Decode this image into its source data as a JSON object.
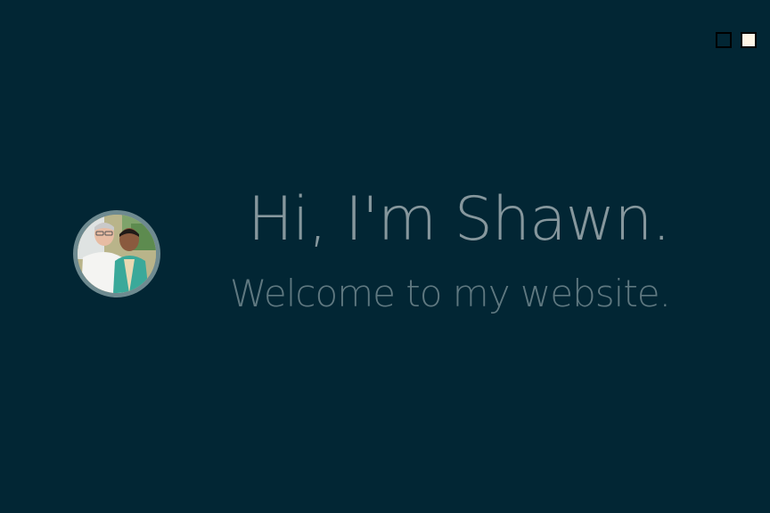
{
  "theme_switcher": {
    "options": [
      "dark",
      "light"
    ],
    "colors": {
      "dark": "#022634",
      "light": "#fdf5e6"
    }
  },
  "hero": {
    "headline": "Hi, I'm Shawn.",
    "subheadline": "Welcome to my website."
  },
  "colors": {
    "background": "#022634",
    "headline": "#86979d",
    "subheadline": "#5f7880",
    "avatar_border": "#6e8a90"
  }
}
